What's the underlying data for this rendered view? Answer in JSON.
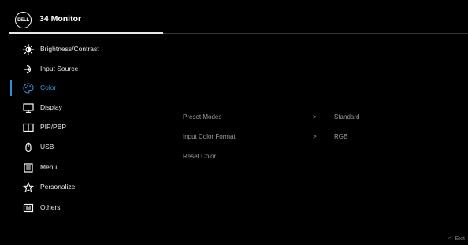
{
  "header": {
    "logo_text": "DELL",
    "model": "34 Monitor"
  },
  "sidebar": {
    "items": [
      {
        "label": "Brightness/Contrast",
        "icon": "brightness-icon"
      },
      {
        "label": "Input Source",
        "icon": "input-source-icon"
      },
      {
        "label": "Color",
        "icon": "color-palette-icon",
        "active": true
      },
      {
        "label": "Display",
        "icon": "display-icon"
      },
      {
        "label": "PIP/PBP",
        "icon": "pip-pbp-icon"
      },
      {
        "label": "USB",
        "icon": "usb-icon"
      },
      {
        "label": "Menu",
        "icon": "menu-icon"
      },
      {
        "label": "Personalize",
        "icon": "star-icon"
      },
      {
        "label": "Others",
        "icon": "others-icon"
      }
    ]
  },
  "submenu": {
    "rows": [
      {
        "label": "Preset Modes",
        "arrow": ">",
        "value": "Standard"
      },
      {
        "label": "Input Color Format",
        "arrow": ">",
        "value": "RGB"
      },
      {
        "label": "Reset Color"
      }
    ]
  },
  "footer": {
    "exit_arrow": "<",
    "exit_label": "Exit"
  },
  "colors": {
    "background": "#000000",
    "accent": "#2e8fd6",
    "text": "#eaeaea",
    "dim_text": "#9a9a9a"
  }
}
